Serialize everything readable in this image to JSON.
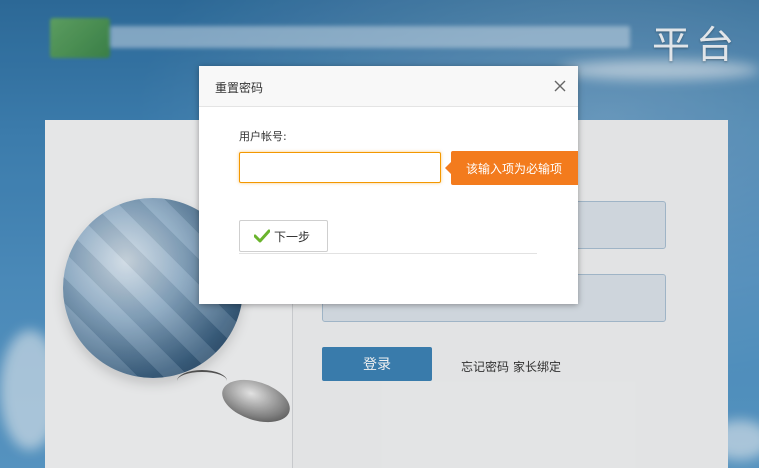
{
  "header": {
    "title": "平台"
  },
  "login": {
    "submit_label": "登录",
    "forgot_link": "忘记密码",
    "parent_link": "家长绑定"
  },
  "dialog": {
    "title": "重置密码",
    "account_label": "用户帐号:",
    "account_value": "",
    "required_tooltip": "该输入项为必输项",
    "next_label": "下一步"
  },
  "icons": {
    "close": "close-icon",
    "check": "check-icon",
    "globe": "globe-puzzle-illustration",
    "mouse": "computer-mouse-illustration"
  },
  "colors": {
    "accent_orange": "#f37b1d",
    "login_blue": "#3d83b6",
    "check_green": "#6ab42d"
  }
}
